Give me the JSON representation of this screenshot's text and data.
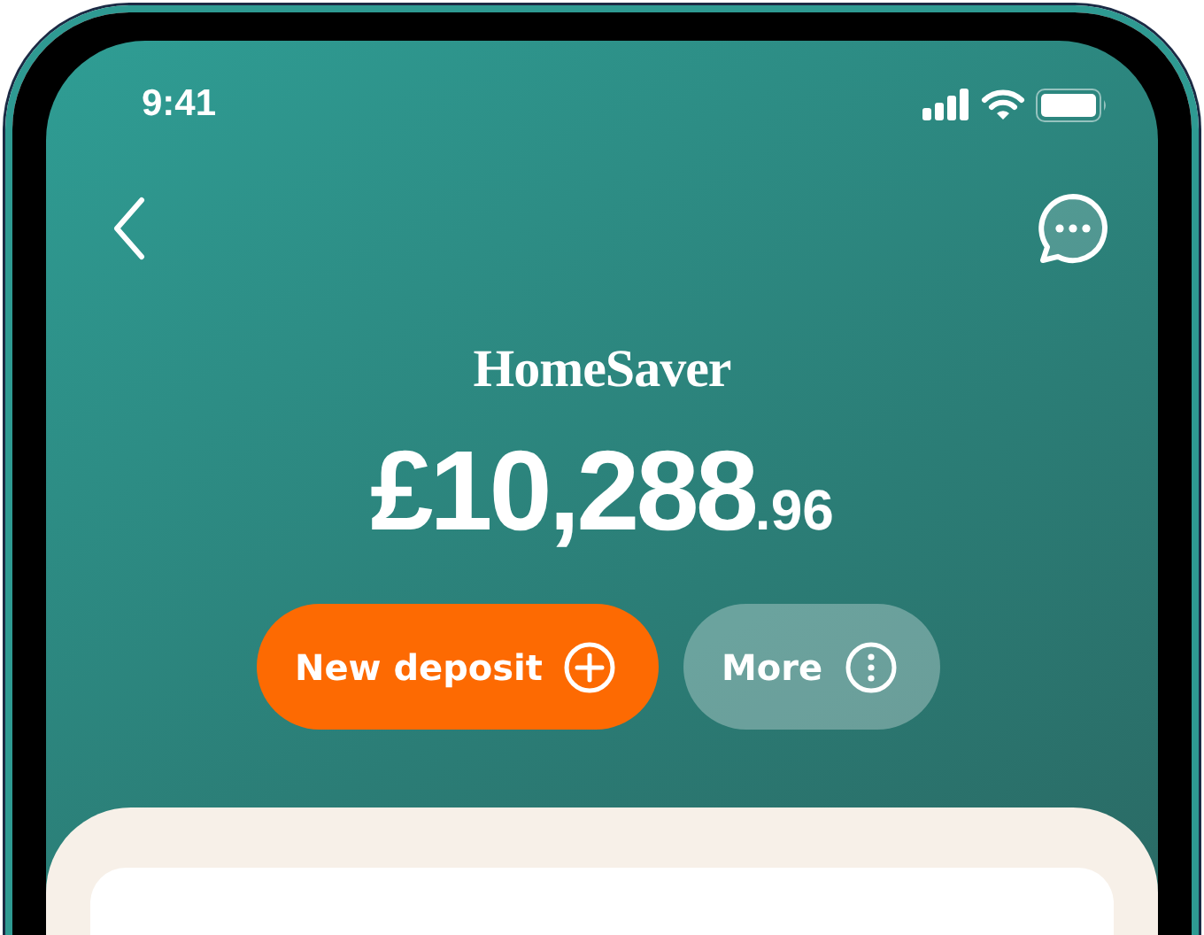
{
  "status_bar": {
    "time": "9:41"
  },
  "account": {
    "name": "HomeSaver",
    "balance_whole": "£10,288",
    "balance_fraction": ".96"
  },
  "actions": [
    {
      "kind": "primary",
      "label": "New deposit"
    },
    {
      "kind": "secondary",
      "label": "More"
    }
  ]
}
